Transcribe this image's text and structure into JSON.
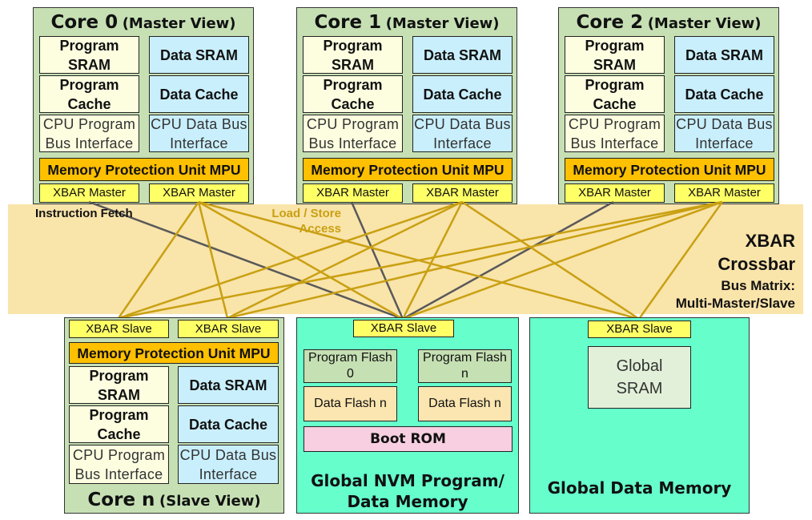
{
  "colors": {
    "band": "#f9e4aa",
    "core": "#c6e0b4",
    "program": "#fdfde0",
    "data": "#c9effc",
    "mpu": "#ffc000",
    "xbar": "#ffff66",
    "global": "#66ffcc",
    "instruction_line": "#595959",
    "load_store_line": "#c9a012"
  },
  "master_cores": [
    {
      "name": "Core 0",
      "view": "(Master View)",
      "program_sram": "Program SRAM",
      "data_sram": "Data SRAM",
      "program_cache": "Program Cache",
      "data_cache": "Data Cache",
      "cpu_program_bus": "CPU Program Bus Interface",
      "cpu_data_bus": "CPU Data Bus Interface",
      "mpu": "Memory Protection Unit MPU",
      "xbar_master_1": "XBAR Master",
      "xbar_master_2": "XBAR Master"
    },
    {
      "name": "Core 1",
      "view": "(Master View)",
      "program_sram": "Program SRAM",
      "data_sram": "Data SRAM",
      "program_cache": "Program Cache",
      "data_cache": "Data Cache",
      "cpu_program_bus": "CPU Program Bus Interface",
      "cpu_data_bus": "CPU Data Bus Interface",
      "mpu": "Memory Protection Unit MPU",
      "xbar_master_1": "XBAR Master",
      "xbar_master_2": "XBAR Master"
    },
    {
      "name": "Core 2",
      "view": "(Master View)",
      "program_sram": "Program SRAM",
      "data_sram": "Data SRAM",
      "program_cache": "Program Cache",
      "data_cache": "Data Cache",
      "cpu_program_bus": "CPU Program Bus Interface",
      "cpu_data_bus": "CPU Data Bus Interface",
      "mpu": "Memory Protection Unit MPU",
      "xbar_master_1": "XBAR Master",
      "xbar_master_2": "XBAR Master"
    }
  ],
  "crossbar": {
    "instruction_fetch": "Instruction Fetch",
    "load_store": "Load / Store Access",
    "title_1": "XBAR",
    "title_2": "Crossbar",
    "subtitle_1": "Bus Matrix:",
    "subtitle_2": "Multi-Master/Slave"
  },
  "slave_core": {
    "name": "Core n",
    "view": "(Slave View)",
    "xbar_slave_1": "XBAR Slave",
    "xbar_slave_2": "XBAR Slave",
    "mpu": "Memory Protection Unit MPU",
    "program_sram": "Program SRAM",
    "data_sram": "Data SRAM",
    "program_cache": "Program Cache",
    "data_cache": "Data Cache",
    "cpu_program_bus": "CPU Program Bus Interface",
    "cpu_data_bus": "CPU Data Bus Interface"
  },
  "nvm": {
    "xbar_slave": "XBAR Slave",
    "program_flash_0": "Program Flash 0",
    "program_flash_n": "Program Flash n",
    "data_flash_1": "Data Flash n",
    "data_flash_2": "Data Flash n",
    "boot_rom": "Boot ROM",
    "title_1": "Global NVM Program/",
    "title_2": "Data Memory"
  },
  "global_data": {
    "xbar_slave": "XBAR Slave",
    "sram": "Global SRAM",
    "title": "Global Data Memory"
  },
  "connections": [
    {
      "from": "core0.m1",
      "to": "nvm",
      "type": "instruction"
    },
    {
      "from": "core1.m1",
      "to": "nvm",
      "type": "instruction"
    },
    {
      "from": "core2.m1",
      "to": "nvm",
      "type": "instruction"
    },
    {
      "from": "core0.m2",
      "to": "coren.s1",
      "type": "load_store"
    },
    {
      "from": "core0.m2",
      "to": "coren.s2",
      "type": "load_store"
    },
    {
      "from": "core0.m2",
      "to": "nvm",
      "type": "load_store"
    },
    {
      "from": "core0.m2",
      "to": "global",
      "type": "load_store"
    },
    {
      "from": "core1.m2",
      "to": "coren.s1",
      "type": "load_store"
    },
    {
      "from": "core1.m2",
      "to": "coren.s2",
      "type": "load_store"
    },
    {
      "from": "core1.m2",
      "to": "nvm",
      "type": "load_store"
    },
    {
      "from": "core1.m2",
      "to": "global",
      "type": "load_store"
    },
    {
      "from": "core2.m2",
      "to": "coren.s1",
      "type": "load_store"
    },
    {
      "from": "core2.m2",
      "to": "coren.s2",
      "type": "load_store"
    },
    {
      "from": "core2.m2",
      "to": "nvm",
      "type": "load_store"
    },
    {
      "from": "core2.m2",
      "to": "global",
      "type": "load_store"
    }
  ]
}
